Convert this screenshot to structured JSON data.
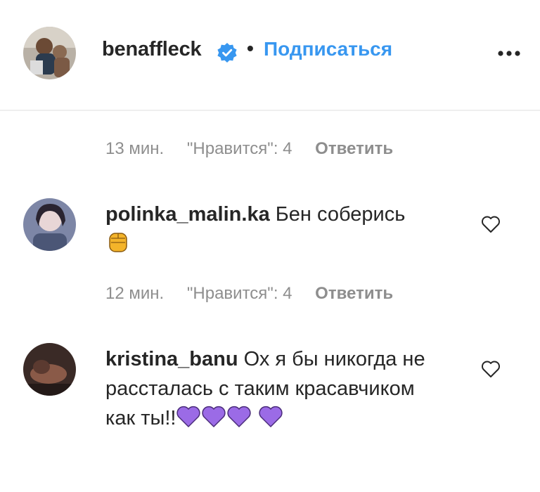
{
  "post_header": {
    "username": "benaffleck",
    "separator": "•",
    "follow_label": "Подписаться",
    "verified_icon": "verified-badge-icon",
    "more_icon": "more-options-icon",
    "accent_color": "#3897f0"
  },
  "comments": [
    {
      "meta": {
        "time": "13 мин.",
        "likes": "\"Нравится\": 4",
        "reply": "Ответить"
      }
    },
    {
      "username": "polinka_malin.ka",
      "text": "Бен соберись",
      "emojis": [
        "raised-fist-emoji"
      ],
      "meta": {
        "time": "12 мин.",
        "likes": "\"Нравится\": 4",
        "reply": "Ответить"
      }
    },
    {
      "username": "kristina_banu",
      "text": "Ох я бы никогда не рассталась с таким красавчиком как ты!!",
      "emojis": [
        "purple-heart-emoji",
        "purple-heart-emoji",
        "purple-heart-emoji",
        "purple-heart-emoji"
      ]
    }
  ],
  "colors": {
    "text": "#262626",
    "secondary": "#8e8e8e",
    "link": "#3897f0",
    "purple_heart": "#9b6be6"
  }
}
